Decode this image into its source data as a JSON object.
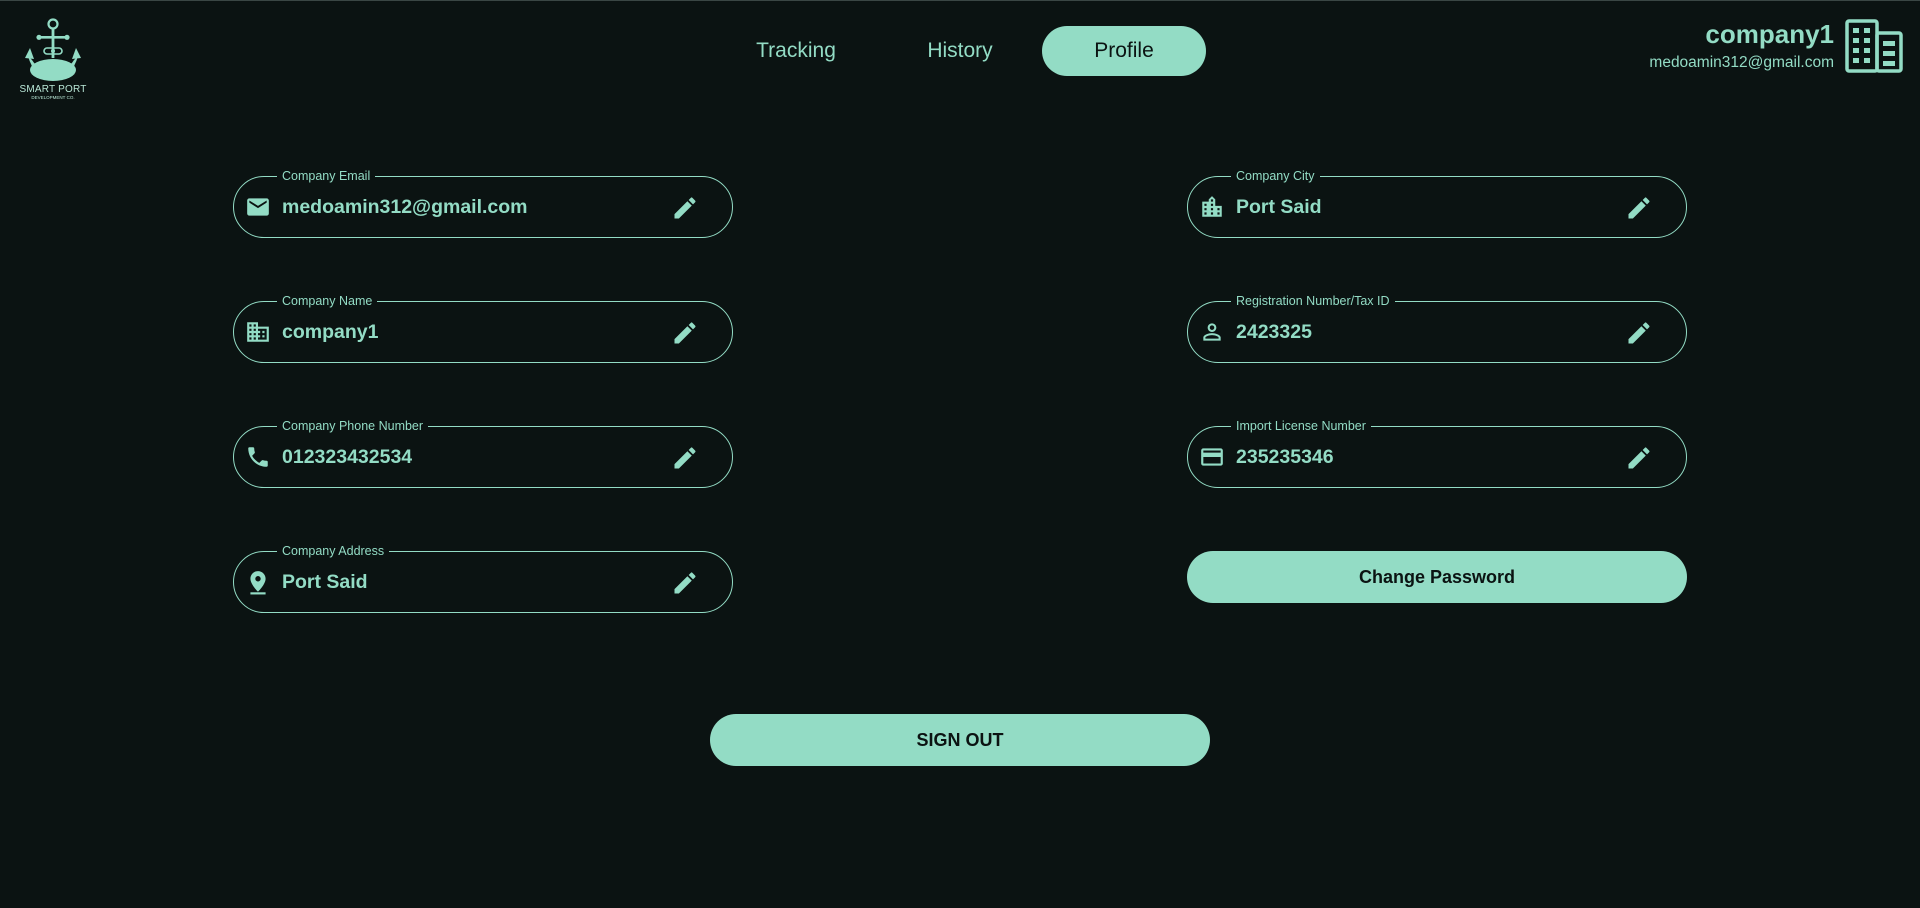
{
  "brand": {
    "logo_text": "SMART PORT",
    "logo_subtext": "DEVELOPMENT CO."
  },
  "nav": {
    "tabs": [
      {
        "label": "Tracking",
        "active": false
      },
      {
        "label": "History",
        "active": false
      },
      {
        "label": "Profile",
        "active": true
      }
    ]
  },
  "user": {
    "name": "company1",
    "email": "medoamin312@gmail.com",
    "icon": "building-icon"
  },
  "fields": {
    "email": {
      "label": "Company Email",
      "value": "medoamin312@gmail.com",
      "icon": "mail-icon"
    },
    "name": {
      "label": "Company Name",
      "value": "company1",
      "icon": "building-icon"
    },
    "phone": {
      "label": "Company Phone Number",
      "value": "012323432534",
      "icon": "phone-icon"
    },
    "address": {
      "label": "Company Address",
      "value": "Port Said",
      "icon": "location-pin-icon"
    },
    "city": {
      "label": "Company City",
      "value": "Port Said",
      "icon": "city-icon"
    },
    "registration": {
      "label": "Registration Number/Tax ID",
      "value": "2423325",
      "icon": "person-icon"
    },
    "license": {
      "label": "Import License Number",
      "value": "235235346",
      "icon": "credit-card-icon"
    }
  },
  "actions": {
    "change_password": "Change Password",
    "sign_out": "SIGN OUT"
  },
  "colors": {
    "background": "#0b1312",
    "accent": "#93dcc5"
  }
}
